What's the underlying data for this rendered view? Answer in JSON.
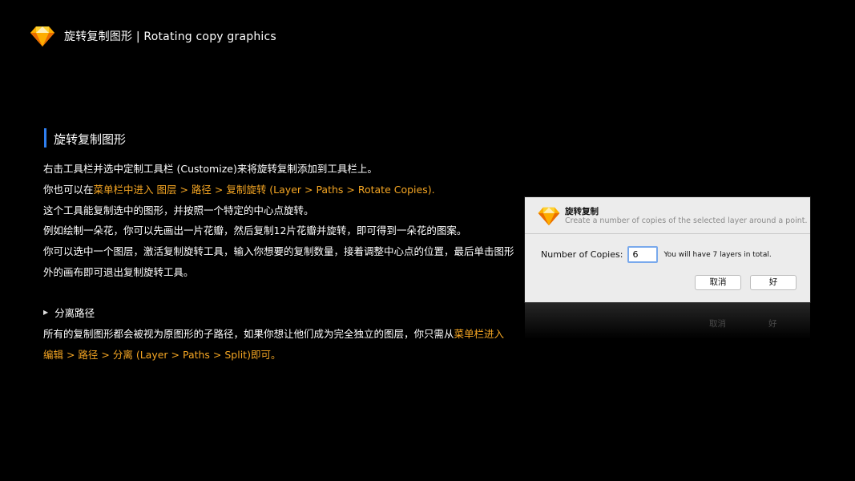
{
  "header": {
    "title": "旋转复制图形 | Rotating copy graphics",
    "logo_icon": "sketch-diamond-icon"
  },
  "section": {
    "title": "旋转复制图形"
  },
  "paragraphs": {
    "p1": "右击工具栏并选中定制工具栏 (Customize)来将旋转复制添加到工具栏上。",
    "p2_prefix": "你也可以在",
    "p2_highlight": "菜单栏中进入 图层 > 路径 > 复制旋转 (Layer > Paths > Rotate Copies).",
    "p3": "这个工具能复制选中的图形，并按照一个特定的中心点旋转。",
    "p4": "例如绘制一朵花，你可以先画出一片花瓣，然后复制12片花瓣并旋转，即可得到一朵花的图案。",
    "p5": "你可以选中一个图层，激活复制旋转工具，输入你想要的复制数量，接着调整中心点的位置，最后单击图形",
    "p6": "外的画布即可退出复制旋转工具。"
  },
  "subsection": {
    "title": "分离路径",
    "line1_prefix": "所有的复制图形都会被视为原图形的子路径，如果你想让他们成为完全独立的图层，你只需从",
    "line1_highlight": "菜单栏进入",
    "line2_highlight": "编辑 > 路径 > 分离 (Layer > Paths > Split)即可。"
  },
  "dialog": {
    "title": "旋转复制",
    "subtitle": "Create a number of copies of the selected layer around a point.",
    "copies_label": "Number of Copies:",
    "copies_value": "6",
    "copies_note": "You will have 7 layers in total.",
    "cancel_label": "取消",
    "ok_label": "好",
    "reflection_cancel": "取消",
    "reflection_ok": "好"
  },
  "colors": {
    "highlight": "#f5a623",
    "accent_bar": "#2f7ff0",
    "background": "#000000"
  }
}
